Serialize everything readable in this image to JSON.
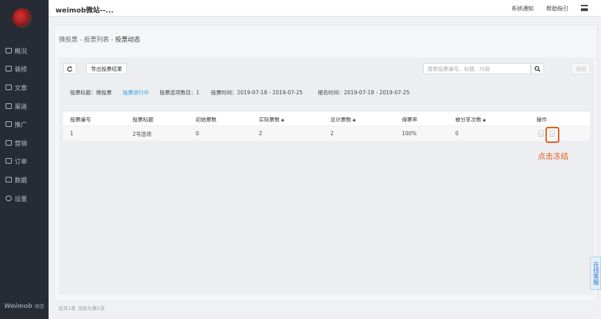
{
  "app": {
    "title": "weimob微站--..."
  },
  "topbar": {
    "notice": "系统通知",
    "help": "帮助指引"
  },
  "sidebar": {
    "items": [
      {
        "label": "概况",
        "icon": "overview-icon"
      },
      {
        "label": "装修",
        "icon": "brush-icon"
      },
      {
        "label": "文章",
        "icon": "article-icon"
      },
      {
        "label": "渠道",
        "icon": "channel-icon"
      },
      {
        "label": "推广",
        "icon": "promotion-icon"
      },
      {
        "label": "营销",
        "icon": "gift-icon"
      },
      {
        "label": "订单",
        "icon": "order-icon"
      },
      {
        "label": "数据",
        "icon": "chart-icon"
      },
      {
        "label": "设置",
        "icon": "gear-icon"
      }
    ],
    "brand": "Weimob",
    "brand_sub": "微盟"
  },
  "breadcrumb": {
    "p1": "微投票",
    "sep": "-",
    "p2": "投票列表",
    "p3": "投票动态"
  },
  "toolbar": {
    "export_label": "导出投票结果",
    "search_placeholder": "搜索投票编号、标题、内容",
    "back_label": "返回"
  },
  "info": {
    "title": "投票标题：微投票",
    "status": "投票进行中",
    "options": "投票选项数目：1",
    "vote_time": "投票时间：2019-07-18 - 2019-07-25",
    "signup_time": "报名时间：2019-07-18 - 2019-07-25"
  },
  "table": {
    "headers": [
      "投票编号",
      "投票标题",
      "初始票数",
      "实际票数",
      "总计票数",
      "得票率",
      "被分享次数",
      "操作"
    ],
    "rows": [
      {
        "id": "1",
        "title": "2号选项",
        "initial": "0",
        "actual": "2",
        "total": "2",
        "rate": "100%",
        "shares": "0"
      }
    ]
  },
  "annotation": {
    "text": "点击冻结"
  },
  "footer": {
    "text": "总共1条 当前为第1页"
  },
  "service": {
    "label": "在线客服"
  },
  "colors": {
    "sidebar": "#272b34",
    "accent": "#2aa3e0",
    "highlight": "#e35a1a"
  }
}
